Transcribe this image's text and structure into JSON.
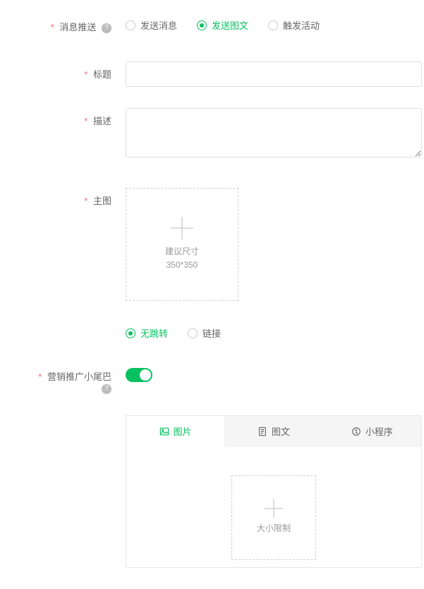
{
  "push": {
    "label": "消息推送",
    "options": [
      {
        "label": "发送消息",
        "checked": false
      },
      {
        "label": "发送图文",
        "checked": true
      },
      {
        "label": "触发活动",
        "checked": false
      }
    ]
  },
  "title": {
    "label": "标题",
    "value": ""
  },
  "desc": {
    "label": "描述",
    "value": ""
  },
  "mainImage": {
    "label": "主图",
    "hint1": "建议尺寸",
    "hint2": "350*350"
  },
  "jump": {
    "options": [
      {
        "label": "无跳转",
        "checked": true
      },
      {
        "label": "链接",
        "checked": false
      }
    ]
  },
  "tail": {
    "label": "营销推广小尾巴",
    "on": true
  },
  "tabs": [
    {
      "label": "图片",
      "active": true
    },
    {
      "label": "图文",
      "active": false
    },
    {
      "label": "小程序",
      "active": false
    }
  ],
  "tailUpload": {
    "hint": "大小限制"
  }
}
